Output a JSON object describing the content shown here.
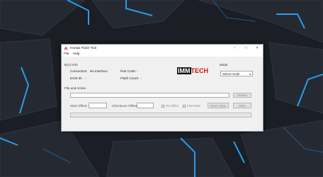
{
  "window": {
    "title": "Honda Flash Tool"
  },
  "menu": [
    "File",
    "Help"
  ],
  "ecu": {
    "group_label": "ECU Info",
    "connection_label": "Connection:",
    "connection_value": "No interface",
    "ecmid_label": "ECM ID:",
    "ecmid_value": "-",
    "partcode_label": "Part Code:",
    "partcode_value": "-",
    "flashcount_label": "Flash Count:",
    "flashcount_value": "-"
  },
  "logo": {
    "part1": "IMM",
    "part2": "TECH"
  },
  "mode": {
    "group_label": "Mode",
    "selected": "Select mode"
  },
  "file": {
    "group_label": "File and Action",
    "browse_label": "Browse",
    "start_offset_label": "Start Offset:",
    "checksum_offset_label": "Checksum Offset:",
    "fix_offset_label": "Fix Offset",
    "fast_write_label": "Fast Write",
    "reset_value_label": "Reset Value",
    "write_label": "Write"
  },
  "colors": {
    "accent_blue": "#2aa8ff",
    "brand_red": "#cc1111"
  }
}
